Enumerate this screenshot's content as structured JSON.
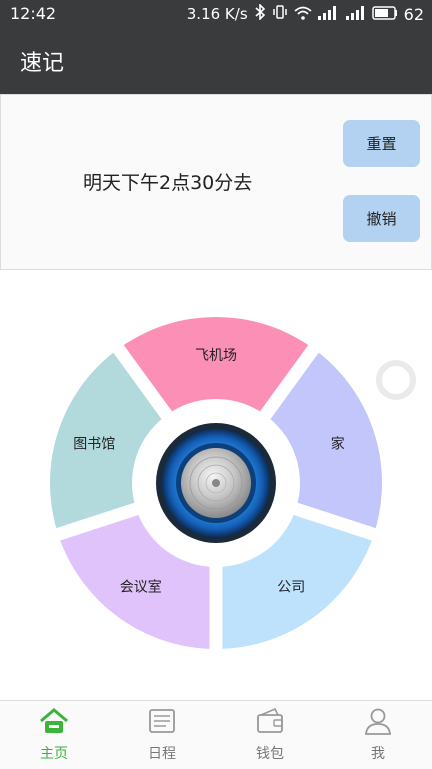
{
  "status_bar": {
    "time": "12:42",
    "network_speed": "3.16 K/s",
    "battery": "62"
  },
  "app_bar": {
    "title": "速记"
  },
  "note": {
    "text": "明天下午2点30分去"
  },
  "actions": {
    "reset_label": "重置",
    "undo_label": "撤销"
  },
  "wheel": {
    "segments": [
      {
        "label": "飞机场",
        "color": "#fc8fb6"
      },
      {
        "label": "家",
        "color": "#c3c6fb"
      },
      {
        "label": "公司",
        "color": "#bfe2fc"
      },
      {
        "label": "会议室",
        "color": "#e1c3fc"
      },
      {
        "label": "图书馆",
        "color": "#b2d9dc"
      }
    ]
  },
  "tabs": [
    {
      "label": "主页",
      "icon": "home-icon",
      "active": true
    },
    {
      "label": "日程",
      "icon": "schedule-icon",
      "active": false
    },
    {
      "label": "钱包",
      "icon": "wallet-icon",
      "active": false
    },
    {
      "label": "我",
      "icon": "profile-icon",
      "active": false
    }
  ],
  "colors": {
    "accent": "#3cb43c",
    "bar": "#3a3b3d",
    "button": "#b3d1f1"
  }
}
